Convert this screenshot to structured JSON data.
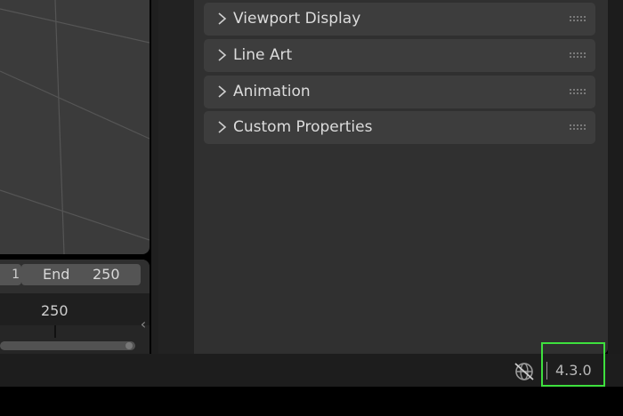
{
  "properties": {
    "panels": [
      {
        "label": "Viewport Display",
        "icon": "chevron-right-icon"
      },
      {
        "label": "Line Art",
        "icon": "chevron-right-icon"
      },
      {
        "label": "Animation",
        "icon": "chevron-right-icon"
      },
      {
        "label": "Custom Properties",
        "icon": "chevron-right-icon"
      }
    ]
  },
  "timeline": {
    "start_partial": "1",
    "end_label": "End",
    "end_value": "250",
    "current_frame": "250"
  },
  "statusbar": {
    "version": "4.3.0",
    "network_icon": "network-disabled-icon"
  },
  "colors": {
    "highlight": "#3ee03e",
    "panel_bg": "#3d3d3d",
    "editor_bg": "#303030"
  }
}
